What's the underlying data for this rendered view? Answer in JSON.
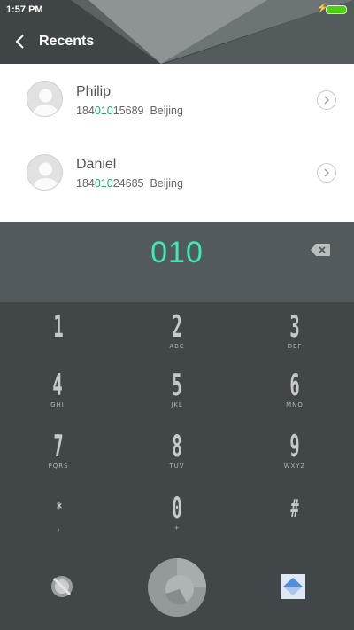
{
  "status_bar": {
    "time": "1:57 PM",
    "charge_glyph": "⚡"
  },
  "header": {
    "title": "Recents"
  },
  "recents": [
    {
      "name": "Philip",
      "number_pre": "184",
      "number_match": "010",
      "number_post": "15689",
      "location": "Beijing"
    },
    {
      "name": "Daniel",
      "number_pre": "184",
      "number_match": "010",
      "number_post": "24685",
      "location": "Beijing"
    }
  ],
  "dialer": {
    "number": "010"
  },
  "keypad": {
    "keys": [
      {
        "digit": "1",
        "letters": ""
      },
      {
        "digit": "2",
        "letters": "ABC"
      },
      {
        "digit": "3",
        "letters": "DEF"
      },
      {
        "digit": "4",
        "letters": "GHI"
      },
      {
        "digit": "5",
        "letters": "JKL"
      },
      {
        "digit": "6",
        "letters": "MNO"
      },
      {
        "digit": "7",
        "letters": "PQRS"
      },
      {
        "digit": "8",
        "letters": "TUV"
      },
      {
        "digit": "9",
        "letters": "WXYZ"
      },
      {
        "digit": "*",
        "letters": ","
      },
      {
        "digit": "0",
        "letters": "+"
      },
      {
        "digit": "#",
        "letters": ""
      }
    ]
  },
  "colors": {
    "accent": "#3ee8b8",
    "match_highlight": "#26a76a",
    "keypad_bg": "#414749",
    "display_bg": "#525a5d",
    "battery": "#4cd10f"
  },
  "icons": {
    "back": "chevron-left-icon",
    "info": "chevron-right-icon",
    "delete": "backspace-icon",
    "voicemail": "voicemail-icon",
    "call": "call-icon",
    "collapse": "collapse-keypad-icon"
  }
}
